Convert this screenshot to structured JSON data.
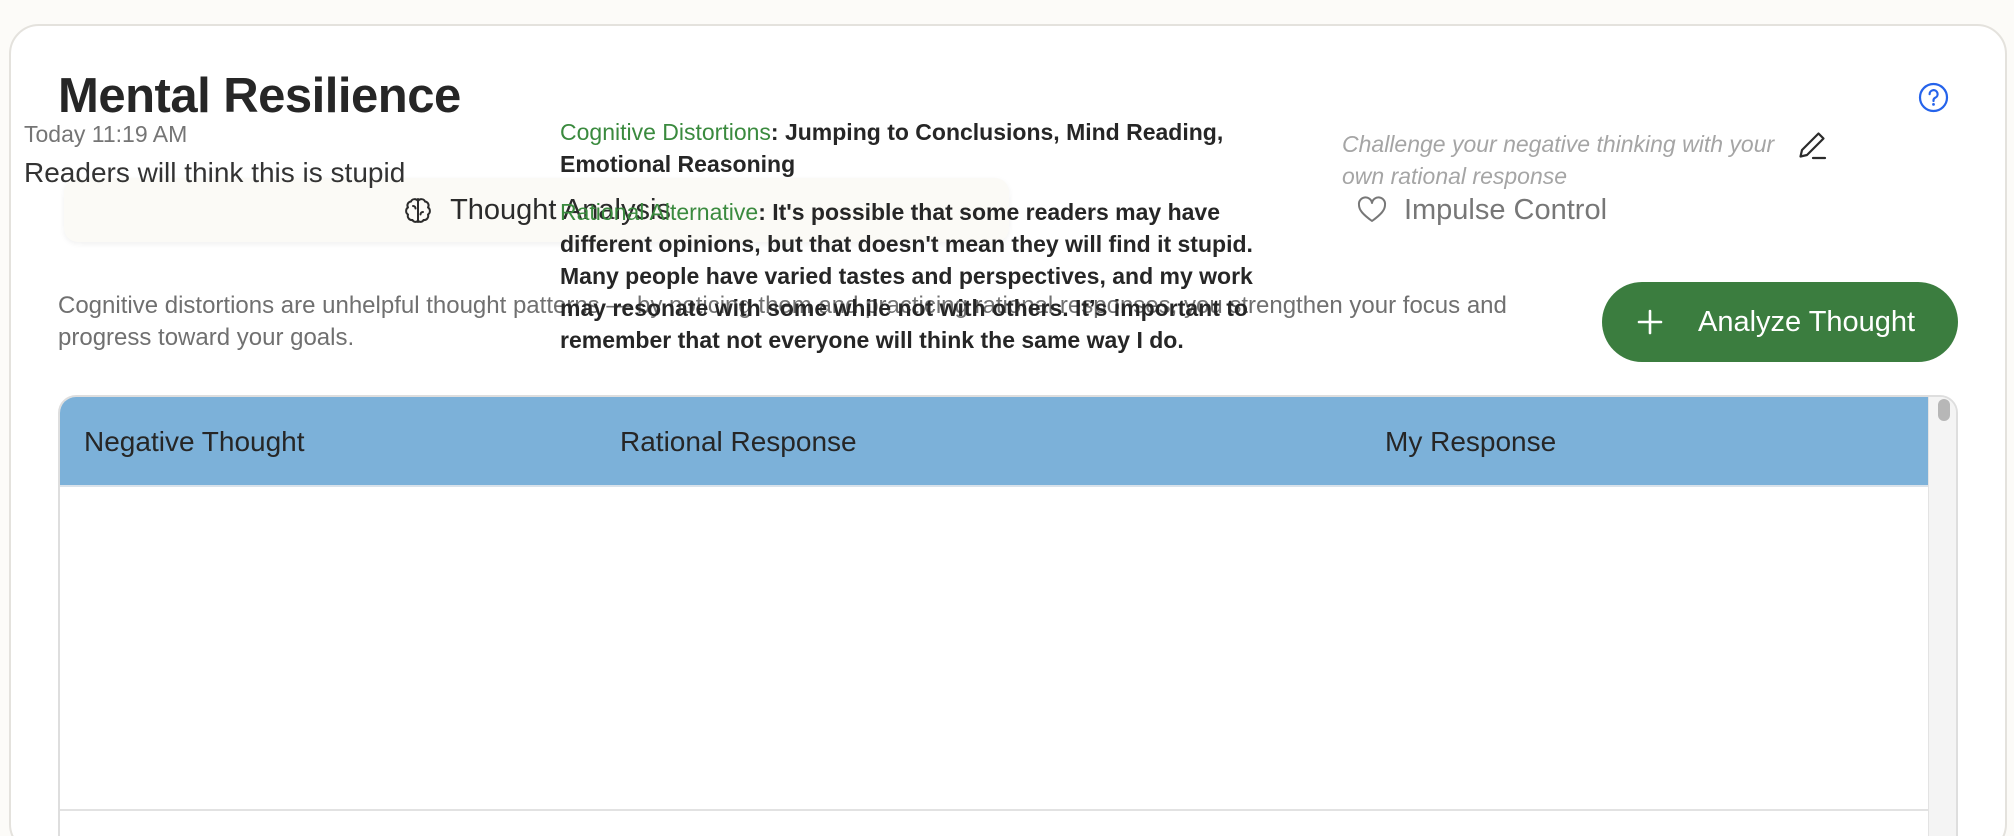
{
  "page": {
    "title": "Mental Resilience"
  },
  "help": {
    "icon": "help-circle-icon"
  },
  "tabs": [
    {
      "label": "Thought Analysis",
      "icon": "brain-icon",
      "active": true
    },
    {
      "label": "Impulse Control",
      "icon": "heart-icon",
      "active": false
    }
  ],
  "intro": "Cognitive distortions are unhelpful thought patterns — by noticing them and practicing rational responses, you strengthen your focus and progress toward your goals.",
  "actions": {
    "analyze_label": "Analyze Thought",
    "analyze_icon": "plus-icon"
  },
  "table": {
    "columns": [
      "Negative Thought",
      "Rational Response",
      "My Response"
    ],
    "rows": [
      {
        "time": "Today 11:19 AM",
        "thought": "Readers will think this is stupid",
        "distortions_label": "Cognitive Distortions",
        "distortions": ": Jumping to Conclusions, Mind Reading, Emotional Reasoning",
        "alternative_label": "Rational Alternative",
        "alternative": ": It's possible that some readers may have different opinions, but that doesn't mean they will find it stupid. Many people have varied tastes and perspectives, and my work may resonate with some while not with others. It’s important to remember that not everyone will think the same way I do.",
        "response_placeholder": "Challenge your negative thinking with your own rational response",
        "edit_icon": "pencil-icon"
      }
    ]
  },
  "colors": {
    "accent_green": "#3b7d3f",
    "header_blue": "#7cb1d9",
    "help_blue": "#2563eb"
  }
}
